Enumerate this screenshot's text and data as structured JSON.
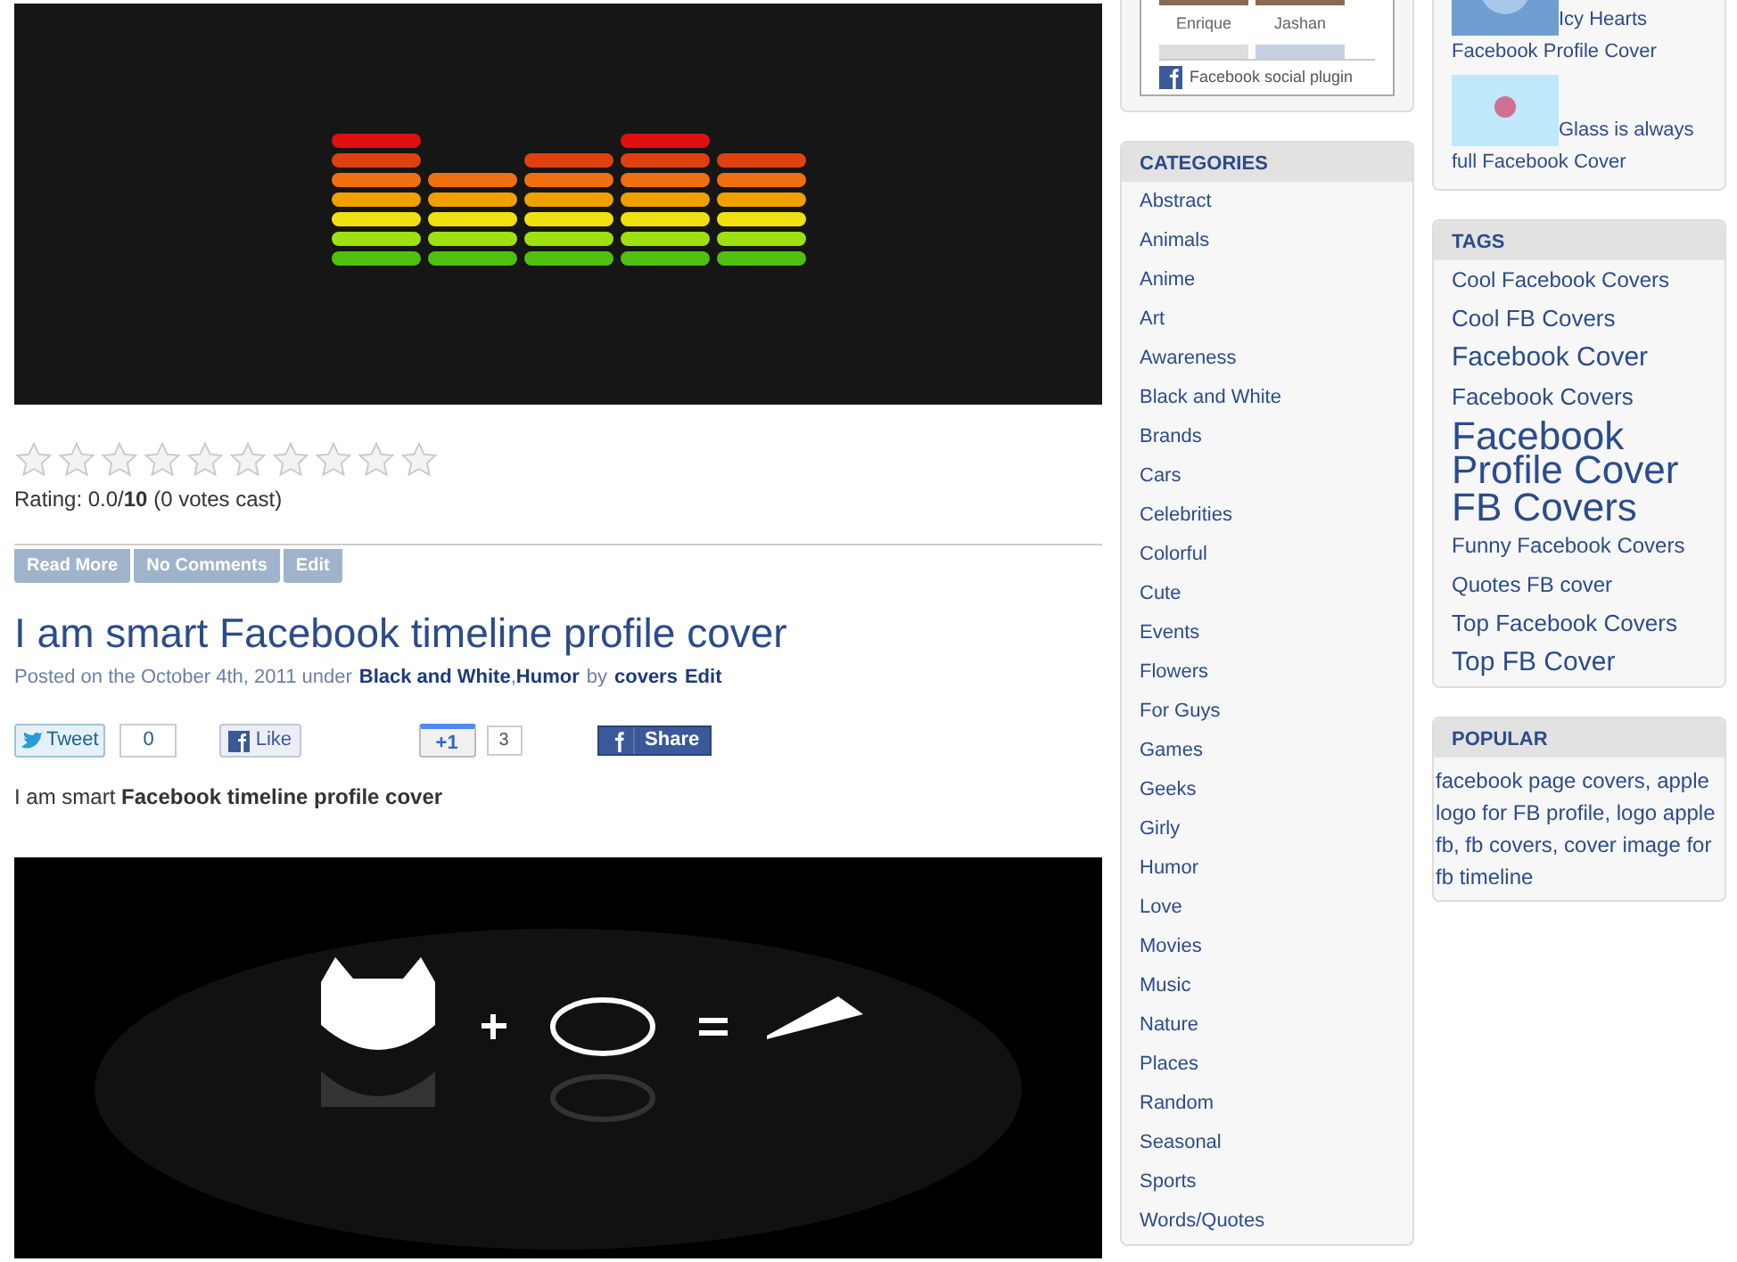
{
  "post_top": {
    "image": {
      "kind": "picture"
    },
    "stars": 0,
    "rating": "Rating: 0.0/**10** (0 votes cast)",
    "actions": [
      "Read More",
      "No Comments",
      "Edit"
    ]
  },
  "post": {
    "title": "I am smart Facebook timeline profile cover",
    "posted": "Posted on the October 4th, 2011 under",
    "categories": [
      "Black and White",
      "Humor"
    ],
    "separator": ",",
    "by": "by",
    "author": "covers",
    "edit": "Edit",
    "social": {
      "tweet": "Tweet",
      "tweet_count": "0",
      "like": "Like",
      "plusone": "+1",
      "plusone_count": "3",
      "share": "Share"
    },
    "excerpt": "I am smart **Facebook timeline profile cover**",
    "image": {
      "kind": "picture"
    }
  },
  "facebook_plugin": {
    "fans": [
      {
        "name": "Enrique"
      },
      {
        "name": "Jashan"
      }
    ],
    "label": "Facebook social plugin"
  },
  "categories": {
    "title": "CATEGORIES",
    "items": [
      "Abstract",
      "Animals",
      "Anime",
      "Art",
      "Awareness",
      "Black and White",
      "Brands",
      "Cars",
      "Celebrities",
      "Colorful",
      "Cute",
      "Events",
      "Flowers",
      "For Guys",
      "Games",
      "Geeks",
      "Girly",
      "Humor",
      "Love",
      "Movies",
      "Music",
      "Nature",
      "Places",
      "Random",
      "Seasonal",
      "Sports",
      "Words/Quotes"
    ]
  },
  "recent": [
    {
      "title_start": "Icy Hearts",
      "title_end": "Facebook Profile Cover"
    },
    {
      "title_start": "Glass is always",
      "title_end": "full Facebook Cover"
    }
  ],
  "tags": {
    "title": "TAGS",
    "items": [
      {
        "label": "Cool Facebook Covers",
        "kind": "small"
      },
      {
        "label": "Cool FB Covers",
        "kind": "medium"
      },
      {
        "label": "Facebook Cover",
        "kind": "large"
      },
      {
        "label": "Facebook Covers",
        "kind": "medium"
      },
      {
        "label": "Facebook Profile Cover",
        "kind": "huge"
      },
      {
        "label": "FB Covers",
        "kind": "huge"
      },
      {
        "label": "Funny Facebook Covers",
        "kind": "small"
      },
      {
        "label": "Quotes FB cover",
        "kind": "small"
      },
      {
        "label": "Top Facebook Covers",
        "kind": "medium"
      },
      {
        "label": "Top FB Cover",
        "kind": "large"
      }
    ]
  },
  "popular": {
    "title": "POPULAR",
    "text": "facebook page covers, apple logo for FB profile, logo apple fb, fb covers, cover image for fb timeline"
  }
}
